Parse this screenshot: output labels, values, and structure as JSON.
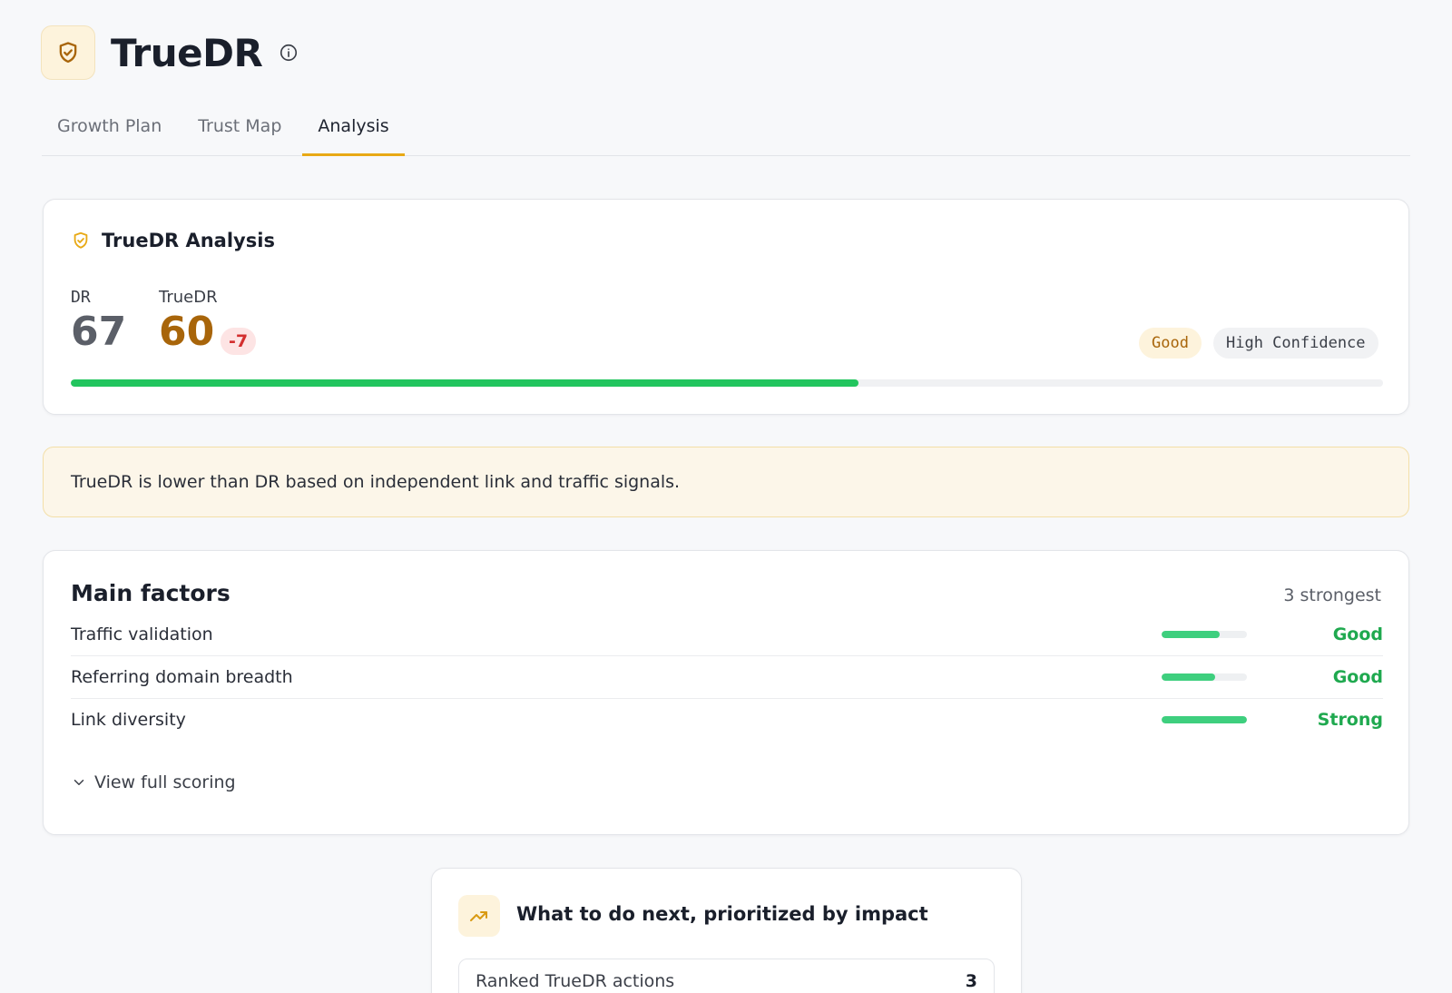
{
  "app": {
    "title": "TrueDR",
    "logo_icon": "shield-check-icon",
    "info_icon": "info-circle-icon"
  },
  "tabs": [
    {
      "label": "Growth Plan",
      "active": false
    },
    {
      "label": "Trust Map",
      "active": false
    },
    {
      "label": "Analysis",
      "active": true
    }
  ],
  "analysis": {
    "title": "TrueDR Analysis",
    "dr_label": "DR",
    "dr_value": "67",
    "truedr_label": "TrueDR",
    "truedr_value": "60",
    "delta": "-7",
    "rating_badge": "Good",
    "confidence_badge": "High Confidence",
    "progress_percent": 60
  },
  "notice": {
    "text": "TrueDR is lower than DR based on independent link and traffic signals."
  },
  "factors": {
    "title": "Main factors",
    "subtitle": "3 strongest",
    "items": [
      {
        "name": "Traffic validation",
        "level": 0.68,
        "status": "Good"
      },
      {
        "name": "Referring domain breadth",
        "level": 0.63,
        "status": "Good"
      },
      {
        "name": "Link diversity",
        "level": 1.0,
        "status": "Strong"
      }
    ],
    "view_full_label": "View full scoring"
  },
  "next": {
    "title": "What to do next, prioritized by impact",
    "icon": "trending-up-icon",
    "ranked_label": "Ranked TrueDR actions",
    "ranked_count": "3"
  },
  "colors": {
    "accent": "#e8a915",
    "truedr": "#a8650a",
    "progress": "#22c55e",
    "negative": "#d32f2f",
    "good": "#1fa94f"
  }
}
